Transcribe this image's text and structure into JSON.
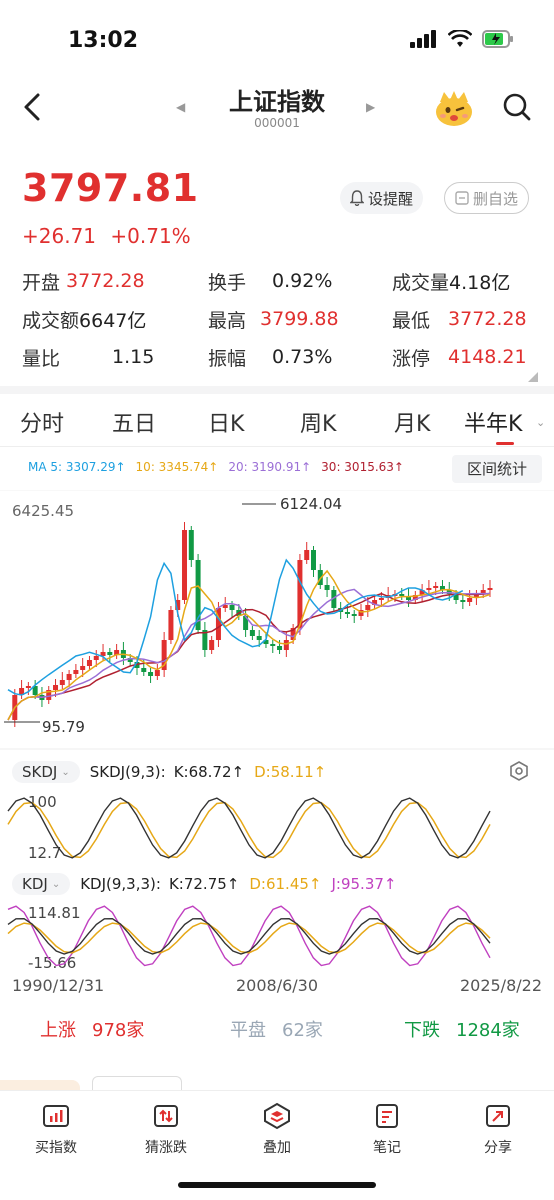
{
  "status_bar": {
    "time": "13:02"
  },
  "header": {
    "title": "上证指数",
    "code": "000001"
  },
  "quote": {
    "price": "3797.81",
    "change": "+26.71",
    "change_pct": "+0.71%",
    "alert_label": "设提醒",
    "fav_label": "删自选"
  },
  "stats": {
    "row1": [
      {
        "label": "开盘",
        "value": "3772.28",
        "color": "red"
      },
      {
        "label": "换手",
        "value": "0.92%",
        "color": "black"
      },
      {
        "label": "成交量",
        "value": "4.18亿",
        "color": "black"
      }
    ],
    "row2": [
      {
        "label": "成交额",
        "value": "6647亿",
        "color": "black"
      },
      {
        "label": "最高",
        "value": "3799.88",
        "color": "red"
      },
      {
        "label": "最低",
        "value": "3772.28",
        "color": "red"
      }
    ],
    "row3": [
      {
        "label": "量比",
        "value": "1.15",
        "color": "black"
      },
      {
        "label": "振幅",
        "value": "0.73%",
        "color": "black"
      },
      {
        "label": "涨停",
        "value": "4148.21",
        "color": "red"
      }
    ]
  },
  "tabs": [
    "分时",
    "五日",
    "日K",
    "周K",
    "月K",
    "半年K"
  ],
  "active_tab": "半年K",
  "ma": {
    "ma5": "MA 5: 3307.29↑",
    "ma10": "10: 3345.74↑",
    "ma20": "20: 3190.91↑",
    "ma30": "30: 3015.63↑"
  },
  "range_stats_label": "区间统计",
  "indicators": {
    "skdj": {
      "tag": "SKDJ",
      "name": "SKDJ(9,3):",
      "k": "K:68.72↑",
      "d": "D:58.11↑",
      "top": "100",
      "bottom": "12.7"
    },
    "kdj": {
      "tag": "KDJ",
      "name": "KDJ(9,3,3):",
      "k": "K:72.75↑",
      "d": "D:61.45↑",
      "j": "J:95.37↑",
      "top": "114.81",
      "bottom": "-15.66"
    }
  },
  "dates": [
    "1990/12/31",
    "2008/6/30",
    "2025/8/22"
  ],
  "breadth": {
    "up_label": "上涨",
    "up": "978家",
    "flat_label": "平盘",
    "flat": "62家",
    "down_label": "下跌",
    "down": "1284家"
  },
  "bottom_bar": [
    "买指数",
    "猜涨跌",
    "叠加",
    "笔记",
    "分享"
  ],
  "colors": {
    "up": "#e0302f",
    "down": "#119944",
    "ma5": "#1ea0e0",
    "ma10": "#e6a817",
    "ma20": "#9b6fd6",
    "ma30": "#b02030"
  },
  "chart_data": {
    "type": "candlestick",
    "period": "半年K",
    "x": [
      "1990/12/31",
      "2008/6/30",
      "2025/8/22"
    ],
    "y_axis_labels": [
      "6425.45"
    ],
    "high_label": "6124.04",
    "low_label": "95.79",
    "ylim": [
      95.79,
      6425.45
    ]
  }
}
